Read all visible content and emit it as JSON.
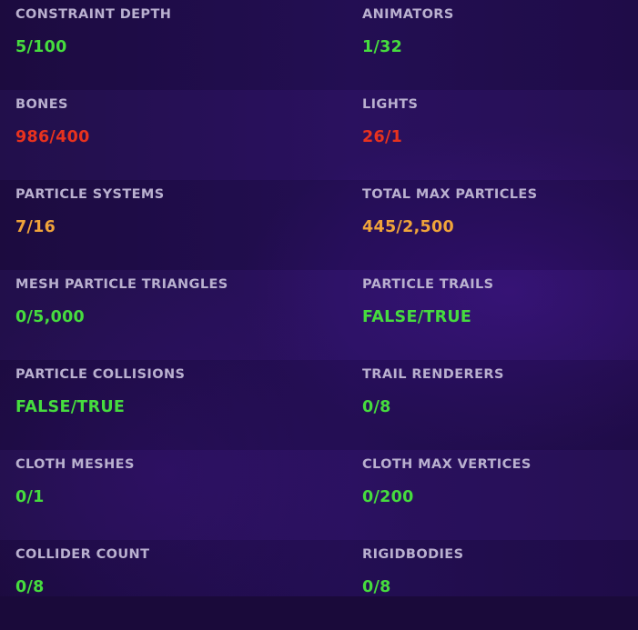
{
  "stats": [
    [
      {
        "label": "CONSTRAINT DEPTH",
        "value": "5/100",
        "status": "ok"
      },
      {
        "label": "ANIMATORS",
        "value": "1/32",
        "status": "ok"
      }
    ],
    [
      {
        "label": "BONES",
        "value": "986/400",
        "status": "bad"
      },
      {
        "label": "LIGHTS",
        "value": "26/1",
        "status": "bad"
      }
    ],
    [
      {
        "label": "PARTICLE SYSTEMS",
        "value": "7/16",
        "status": "warn"
      },
      {
        "label": "TOTAL MAX PARTICLES",
        "value": "445/2,500",
        "status": "warn"
      }
    ],
    [
      {
        "label": "MESH PARTICLE TRIANGLES",
        "value": "0/5,000",
        "status": "ok"
      },
      {
        "label": "PARTICLE TRAILS",
        "value": "FALSE/TRUE",
        "status": "ok"
      }
    ],
    [
      {
        "label": "PARTICLE COLLISIONS",
        "value": "FALSE/TRUE",
        "status": "ok"
      },
      {
        "label": "TRAIL RENDERERS",
        "value": "0/8",
        "status": "ok"
      }
    ],
    [
      {
        "label": "CLOTH MESHES",
        "value": "0/1",
        "status": "ok"
      },
      {
        "label": "CLOTH MAX VERTICES",
        "value": "0/200",
        "status": "ok"
      }
    ],
    [
      {
        "label": "COLLIDER COUNT",
        "value": "0/8",
        "status": "ok"
      },
      {
        "label": "RIGIDBODIES",
        "value": "0/8",
        "status": "ok"
      }
    ]
  ],
  "colors": {
    "ok": "#46dc3e",
    "warn": "#f0a43a",
    "bad": "#e8321e",
    "label": "#b9b0cf",
    "background": "#1d0c3e"
  }
}
